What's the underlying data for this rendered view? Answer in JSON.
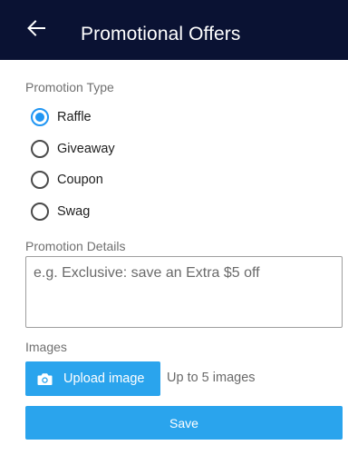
{
  "header": {
    "title": "Promotional Offers",
    "back_icon": "arrow-left-icon"
  },
  "promotion_type": {
    "label": "Promotion Type",
    "options": [
      {
        "label": "Raffle",
        "selected": true
      },
      {
        "label": "Giveaway",
        "selected": false
      },
      {
        "label": "Coupon",
        "selected": false
      },
      {
        "label": "Swag",
        "selected": false
      }
    ]
  },
  "promotion_details": {
    "label": "Promotion Details",
    "value": "",
    "placeholder": "e.g. Exclusive: save an Extra $5 off"
  },
  "images": {
    "label": "Images",
    "upload_label": "Upload image",
    "upload_icon": "camera-icon",
    "hint": "Up to 5 images"
  },
  "save_label": "Save",
  "colors": {
    "app_bar": "#0a1233",
    "accent": "#2196f3",
    "button": "#2aa4ed"
  }
}
